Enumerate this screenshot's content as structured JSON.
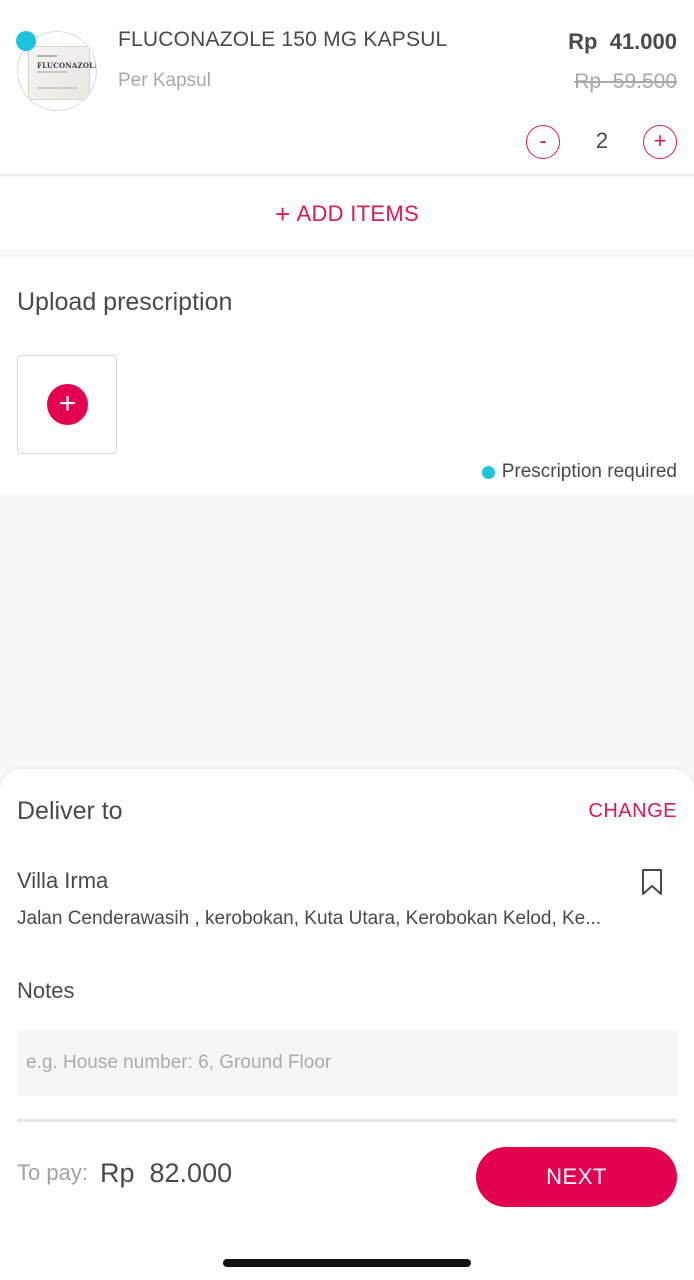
{
  "product": {
    "name": "FLUCONAZOLE 150 MG KAPSUL",
    "unit": "Per Kapsul",
    "price": "Rp  41.000",
    "original_price": "Rp  59.500",
    "quantity": "2",
    "minus_label": "-",
    "plus_label": "+",
    "thumbnail_text": "FLUCONAZOLE",
    "thumbnail_icon": "medicine-box-icon"
  },
  "add_items": {
    "icon": "+",
    "label": "ADD ITEMS"
  },
  "prescription": {
    "title": "Upload prescription",
    "upload_icon": "+",
    "required_text": "Prescription required"
  },
  "delivery": {
    "title": "Deliver to",
    "change_label": "CHANGE",
    "address_name": "Villa Irma",
    "address_line": "Jalan Cenderawasih , kerobokan, Kuta Utara, Kerobokan Kelod, Ke...",
    "bookmark_icon": "bookmark-icon"
  },
  "notes": {
    "label": "Notes",
    "value": "",
    "placeholder": "e.g. House number: 6, Ground Floor"
  },
  "footer": {
    "to_pay_label": "To pay:",
    "amount": "Rp  82.000",
    "next_label": "NEXT"
  },
  "colors": {
    "accent": "#e2004f",
    "accent_text": "#d81b52",
    "rx_indicator": "#1ec3e0",
    "text": "#4a4a4a",
    "muted": "#a8a8a8",
    "background": "#f8f8f8"
  }
}
